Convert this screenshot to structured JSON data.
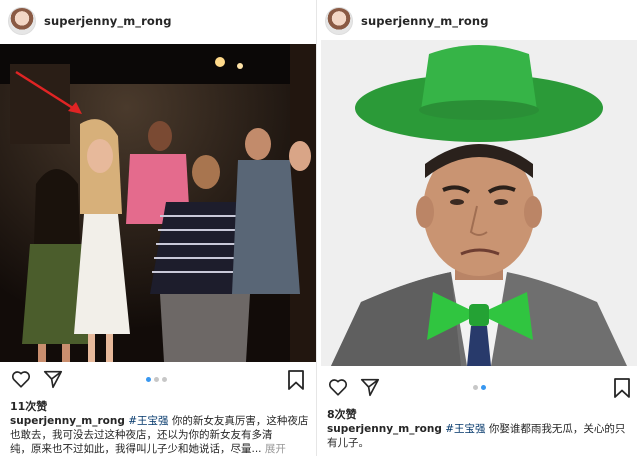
{
  "left_post": {
    "username": "superjenny_m_rong",
    "likes": "11次赞",
    "caption_user": "superjenny_m_rong",
    "caption_tag": "#王宝强",
    "caption_line1": " 你的新女友真厉害，这种夜店",
    "caption_line2": "也敢去，我可没去过这种夜店，还以为你的新女友有多清",
    "caption_line3": "纯，原来也不过如此，我得叫儿子少和她说话，尽量...",
    "more_label": "展开",
    "carousel": {
      "count": 3,
      "active": 1
    }
  },
  "right_post": {
    "username": "superjenny_m_rong",
    "likes": "8次赞",
    "caption_user": "superjenny_m_rong",
    "caption_tag": "#王宝强",
    "caption_line1": " 你娶谁都雨我无瓜，关心的只",
    "caption_line2": "有儿子。",
    "carousel": {
      "count": 2,
      "active": 1
    }
  },
  "icons": [
    "heart-icon",
    "share-icon",
    "bookmark-icon"
  ],
  "colors": {
    "accent": "#3897f0",
    "hat_green": "#2faa3c",
    "bowtie_green": "#2ec63f"
  }
}
